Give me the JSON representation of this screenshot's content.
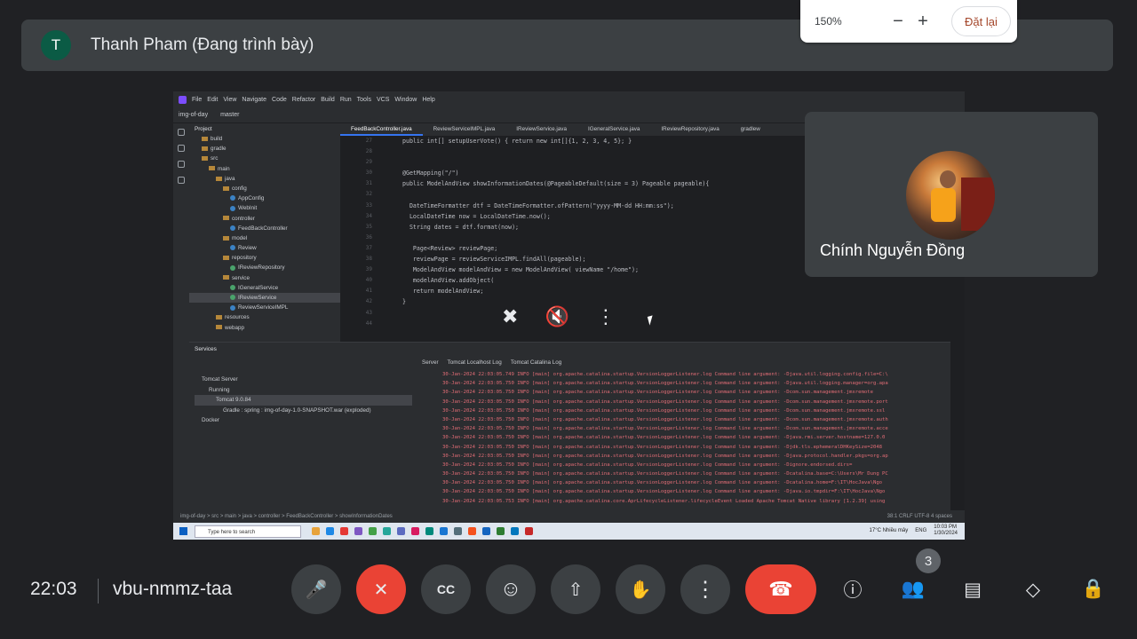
{
  "top": {
    "avatar_letter": "T",
    "presenter": "Thanh Pham (Đang trình bày)"
  },
  "zoom": {
    "level": "150%",
    "minus": "−",
    "plus": "+",
    "reset": "Đặt lại"
  },
  "ide": {
    "menu": [
      "File",
      "Edit",
      "View",
      "Navigate",
      "Code",
      "Refactor",
      "Build",
      "Run",
      "Tools",
      "VCS",
      "Window",
      "Help"
    ],
    "project_name": "img-of-day",
    "branch": "master",
    "project_header": "Project",
    "tree": [
      {
        "label": "build",
        "type": "fold",
        "indent": 1
      },
      {
        "label": "gradle",
        "type": "fold",
        "indent": 1
      },
      {
        "label": "src",
        "type": "fold",
        "indent": 1
      },
      {
        "label": "main",
        "type": "fold",
        "indent": 2
      },
      {
        "label": "java",
        "type": "fold",
        "indent": 3
      },
      {
        "label": "config",
        "type": "fold",
        "indent": 4
      },
      {
        "label": "AppConfig",
        "type": "cls",
        "indent": 5
      },
      {
        "label": "WebInit",
        "type": "cls",
        "indent": 5
      },
      {
        "label": "controller",
        "type": "fold",
        "indent": 4
      },
      {
        "label": "FeedBackController",
        "type": "cls",
        "indent": 5
      },
      {
        "label": "model",
        "type": "fold",
        "indent": 4
      },
      {
        "label": "Review",
        "type": "cls",
        "indent": 5
      },
      {
        "label": "repository",
        "type": "fold",
        "indent": 4
      },
      {
        "label": "IReviewRepository",
        "type": "itf",
        "indent": 5
      },
      {
        "label": "service",
        "type": "fold",
        "indent": 4
      },
      {
        "label": "IGeneralService",
        "type": "itf",
        "indent": 5
      },
      {
        "label": "IReviewService",
        "type": "itf",
        "indent": 5,
        "selected": true
      },
      {
        "label": "ReviewServiceIMPL",
        "type": "cls",
        "indent": 5
      },
      {
        "label": "resources",
        "type": "fold",
        "indent": 3
      },
      {
        "label": "webapp",
        "type": "fold",
        "indent": 3
      }
    ],
    "tabs": [
      "FeedBackController.java",
      "ReviewServiceIMPL.java",
      "IReviewService.java",
      "IGeneralService.java",
      "IReviewRepository.java",
      "gradlew"
    ],
    "line_numbers": [
      "27",
      "28",
      "29",
      "30",
      "31",
      "32",
      "33",
      "34",
      "35",
      "36",
      "37",
      "38",
      "39",
      "40",
      "41",
      "42",
      "43",
      "44"
    ],
    "code": [
      "public int[] setupUserVote() { return new int[]{1, 2, 3, 4, 5}; }",
      "",
      "",
      "@GetMapping(\"/\")",
      "public ModelAndView showInformationDates(@PageableDefault(size = 3) Pageable pageable){",
      "",
      "  DateTimeFormatter dtf = DateTimeFormatter.ofPattern(\"yyyy-MM-dd HH:mm:ss\");",
      "  LocalDateTime now = LocalDateTime.now();",
      "  String dates = dtf.format(now);",
      "",
      "   Page<Review> reviewPage;",
      "   reviewPage = reviewServiceIMPL.findAll(pageable);",
      "   ModelAndView modelAndView = new ModelAndView( viewName \"/home\");",
      "   modelAndView.addObject(",
      "   return modelAndView;",
      "}",
      "",
      ""
    ],
    "services_header": "Services",
    "services_tree": [
      {
        "label": "Tomcat Server",
        "indent": 1
      },
      {
        "label": "Running",
        "indent": 2
      },
      {
        "label": "Tomcat 9.0.84",
        "indent": 3,
        "selected": true
      },
      {
        "label": "Gradle : spring : img-of-day-1.0-SNAPSHOT.war (exploded)",
        "indent": 4
      },
      {
        "label": "Docker",
        "indent": 1
      }
    ],
    "log_tabs": [
      "Server",
      "Tomcat Localhost Log",
      "Tomcat Catalina Log"
    ],
    "log_lines": [
      "30-Jan-2024 22:03:05.749 INFO [main] org.apache.catalina.startup.VersionLoggerListener.log Command line argument: -Djava.util.logging.config.file=C:\\",
      "30-Jan-2024 22:03:05.750 INFO [main] org.apache.catalina.startup.VersionLoggerListener.log Command line argument: -Djava.util.logging.manager=org.apa",
      "30-Jan-2024 22:03:05.750 INFO [main] org.apache.catalina.startup.VersionLoggerListener.log Command line argument: -Dcom.sun.management.jmxremote",
      "30-Jan-2024 22:03:05.750 INFO [main] org.apache.catalina.startup.VersionLoggerListener.log Command line argument: -Dcom.sun.management.jmxremote.port",
      "30-Jan-2024 22:03:05.750 INFO [main] org.apache.catalina.startup.VersionLoggerListener.log Command line argument: -Dcom.sun.management.jmxremote.ssl",
      "30-Jan-2024 22:03:05.750 INFO [main] org.apache.catalina.startup.VersionLoggerListener.log Command line argument: -Dcom.sun.management.jmxremote.auth",
      "30-Jan-2024 22:03:05.750 INFO [main] org.apache.catalina.startup.VersionLoggerListener.log Command line argument: -Dcom.sun.management.jmxremote.acce",
      "30-Jan-2024 22:03:05.750 INFO [main] org.apache.catalina.startup.VersionLoggerListener.log Command line argument: -Djava.rmi.server.hostname=127.0.0",
      "30-Jan-2024 22:03:05.750 INFO [main] org.apache.catalina.startup.VersionLoggerListener.log Command line argument: -Djdk.tls.ephemeralDHKeySize=2048",
      "30-Jan-2024 22:03:05.750 INFO [main] org.apache.catalina.startup.VersionLoggerListener.log Command line argument: -Djava.protocol.handler.pkgs=org.ap",
      "30-Jan-2024 22:03:05.750 INFO [main] org.apache.catalina.startup.VersionLoggerListener.log Command line argument: -Dignore.endorsed.dirs=",
      "30-Jan-2024 22:03:05.750 INFO [main] org.apache.catalina.startup.VersionLoggerListener.log Command line argument: -Dcatalina.base=C:\\Users\\Mr Dung PC",
      "30-Jan-2024 22:03:05.750 INFO [main] org.apache.catalina.startup.VersionLoggerListener.log Command line argument: -Dcatalina.home=F:\\IT\\HocJava\\Ngo",
      "30-Jan-2024 22:03:05.750 INFO [main] org.apache.catalina.startup.VersionLoggerListener.log Command line argument: -Djava.io.tmpdir=F:\\IT\\HocJava\\Ngo",
      "30-Jan-2024 22:03:05.753 INFO [main] org.apache.catalina.core.AprLifecycleListener.lifecycleEvent Loaded Apache Tomcat Native library [1.2.39] using"
    ],
    "breadcrumb": "img-of-day > src > main > java > controller > FeedBackController > showInformationDates",
    "status_right": "38:1   CRLF   UTF-8   4 spaces",
    "taskbar_search": "Type here to search",
    "weather": "17°C  Nhiều mây",
    "lang": "ENG",
    "time_small": "10:03 PM",
    "date_small": "1/30/2024"
  },
  "participant": {
    "name": "Chính Nguyễn Đồng"
  },
  "bottom": {
    "clock": "22:03",
    "meeting_code": "vbu-nmmz-taa",
    "people_count": "3"
  },
  "icons": {
    "mic": "🎤",
    "camera_off": "✕",
    "cc": "CC",
    "emoji": "☺",
    "present": "⇧",
    "hand": "✋",
    "more": "⋮",
    "end_call": "☎",
    "info": "ⓘ",
    "people": "👥",
    "chat": "▤",
    "activities": "◇",
    "lock": "🔒",
    "pin_off": "✖",
    "mute_off": "🔇"
  },
  "colors": {
    "accent_red": "#ea4335",
    "background": "#202124",
    "panel": "#3c4043"
  }
}
